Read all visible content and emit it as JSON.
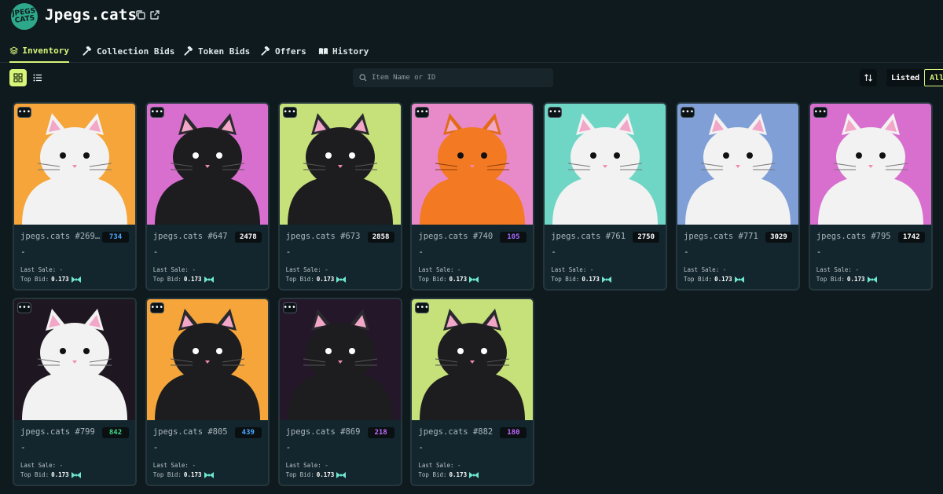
{
  "collection": {
    "logo_text": "JPEGS CATS",
    "title": "Jpegs.cats"
  },
  "tabs": [
    {
      "label": "Inventory",
      "icon": "layers-icon",
      "active": true
    },
    {
      "label": "Collection Bids",
      "icon": "gavel-icon",
      "active": false
    },
    {
      "label": "Token Bids",
      "icon": "gavel-icon",
      "active": false
    },
    {
      "label": "Offers",
      "icon": "gavel-icon",
      "active": false
    },
    {
      "label": "History",
      "icon": "book-icon",
      "active": false
    }
  ],
  "toolbar": {
    "search_placeholder": "Item Name or ID",
    "filters": [
      {
        "label": "Listed",
        "active": false
      },
      {
        "label": "All",
        "active": true
      }
    ]
  },
  "colors": {
    "accent": "#d8f57a",
    "bid_icon": "#6ee7d0"
  },
  "card_labels": {
    "last_sale": "Last Sale: -",
    "top_bid_label": "Top Bid:",
    "menu": "•••"
  },
  "items": [
    {
      "name": "jpegs.cats #269…",
      "rank": "734",
      "rank_color": "#4aa8ff",
      "price": "-",
      "top_bid": "0.173",
      "bg": "#f5a53a",
      "cat": "white"
    },
    {
      "name": "jpegs.cats #647",
      "rank": "2478",
      "rank_color": "#ffffff",
      "price": "-",
      "top_bid": "0.173",
      "bg": "#d86fcf",
      "cat": "black"
    },
    {
      "name": "jpegs.cats #673",
      "rank": "2858",
      "rank_color": "#ffffff",
      "price": "-",
      "top_bid": "0.173",
      "bg": "#c6e07a",
      "cat": "black"
    },
    {
      "name": "jpegs.cats #740",
      "rank": "105",
      "rank_color": "#a56bff",
      "price": "-",
      "top_bid": "0.173",
      "bg": "#e889c9",
      "cat": "orange"
    },
    {
      "name": "jpegs.cats #761",
      "rank": "2750",
      "rank_color": "#ffffff",
      "price": "-",
      "top_bid": "0.173",
      "bg": "#6fd6c6",
      "cat": "white"
    },
    {
      "name": "jpegs.cats #771",
      "rank": "3029",
      "rank_color": "#ffffff",
      "price": "-",
      "top_bid": "0.173",
      "bg": "#7f9fd6",
      "cat": "white"
    },
    {
      "name": "jpegs.cats #795",
      "rank": "1742",
      "rank_color": "#ffffff",
      "price": "-",
      "top_bid": "0.173",
      "bg": "#d86fcf",
      "cat": "white"
    },
    {
      "name": "jpegs.cats #799",
      "rank": "842",
      "rank_color": "#3ddc84",
      "price": "-",
      "top_bid": "0.173",
      "bg": "#1e1620",
      "cat": "white"
    },
    {
      "name": "jpegs.cats #805",
      "rank": "439",
      "rank_color": "#4aa8ff",
      "price": "-",
      "top_bid": "0.173",
      "bg": "#f5a53a",
      "cat": "black"
    },
    {
      "name": "jpegs.cats #869",
      "rank": "218",
      "rank_color": "#c36bff",
      "price": "-",
      "top_bid": "0.173",
      "bg": "#24172a",
      "cat": "black"
    },
    {
      "name": "jpegs.cats #882",
      "rank": "180",
      "rank_color": "#c36bff",
      "price": "-",
      "top_bid": "0.173",
      "bg": "#c6e07a",
      "cat": "black"
    }
  ]
}
